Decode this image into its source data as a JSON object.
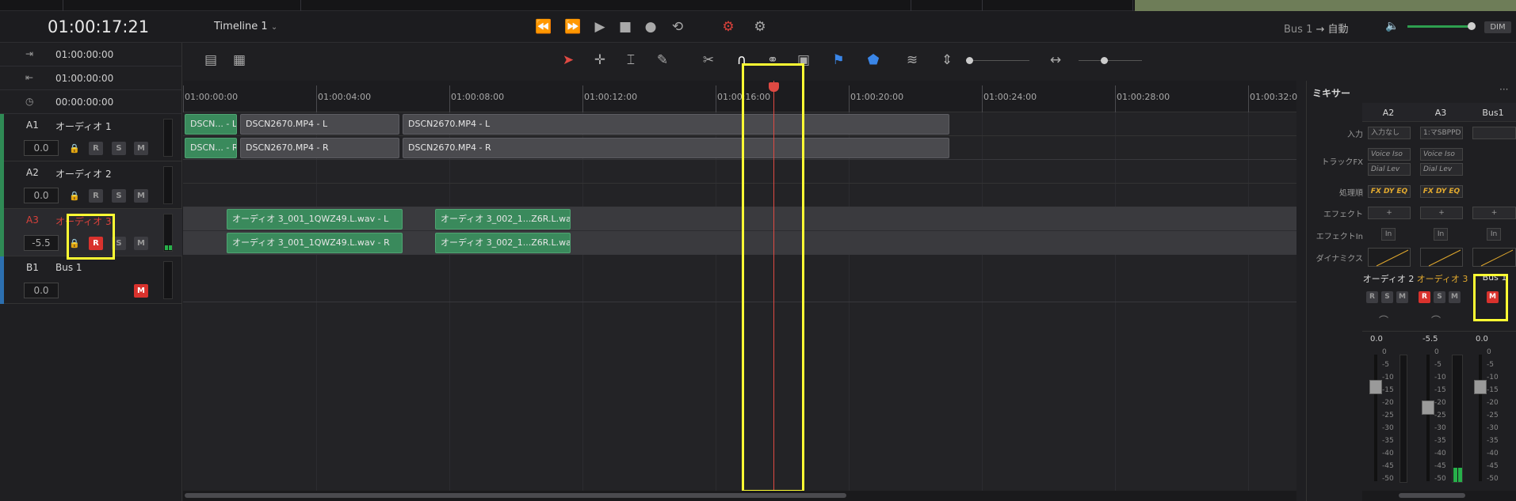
{
  "header": {
    "timecode": "01:00:17:21",
    "timeline_name": "Timeline 1",
    "bus_route": "Bus 1",
    "route_target": "自動",
    "dim_label": "DIM"
  },
  "left_panel": {
    "timecodes": [
      {
        "icon": "in-point-icon",
        "value": "01:00:00:00"
      },
      {
        "icon": "out-point-icon",
        "value": "01:00:00:00"
      },
      {
        "icon": "duration-icon",
        "value": "00:00:00:00"
      }
    ],
    "tracks": [
      {
        "id": "A1",
        "name": "オーディオ 1",
        "volume": "0.0",
        "color": "#2f8a55",
        "buttons": [
          "R",
          "S",
          "M"
        ]
      },
      {
        "id": "A2",
        "name": "オーディオ 2",
        "volume": "0.0",
        "color": "#2f8a55",
        "buttons": [
          "R",
          "S",
          "M"
        ]
      },
      {
        "id": "A3",
        "name": "オーディオ 3",
        "volume": "-5.5",
        "color": "#2f8a55",
        "buttons": [
          "R",
          "S",
          "M"
        ],
        "armed": true
      },
      {
        "id": "B1",
        "name": "Bus 1",
        "volume": "0.0",
        "color": "#2c6fb0",
        "buttons": [
          "M"
        ]
      }
    ]
  },
  "ruler": {
    "labels": [
      "01:00:00:00",
      "01:00:04:00",
      "01:00:08:00",
      "01:00:12:00",
      "01:00:16:00",
      "01:00:20:00",
      "01:00:24:00",
      "01:00:28:00",
      "01:00:32:0"
    ]
  },
  "clips": {
    "a1_l": [
      "DSCN... - L",
      "DSCN2670.MP4 - L",
      "DSCN2670.MP4 - L"
    ],
    "a1_r": [
      "DSCN... - R",
      "DSCN2670.MP4 - R",
      "DSCN2670.MP4 - R"
    ],
    "a3_l": [
      "オーディオ 3_001_1QWZ49.L.wav - L",
      "オーディオ 3_002_1...Z6R.L.wav - L"
    ],
    "a3_r": [
      "オーディオ 3_001_1QWZ49.L.wav - R",
      "オーディオ 3_002_1...Z6R.L.wav - R"
    ]
  },
  "mixer": {
    "title": "ミキサー",
    "columns": [
      "A2",
      "A3",
      "Bus1"
    ],
    "row_labels": [
      "入力",
      "トラックFX",
      "処理順",
      "エフェクト",
      "エフェクトIn",
      "ダイナミクス"
    ],
    "input_values": [
      "入力なし",
      "1:マSBPPD",
      ""
    ],
    "trackfx": [
      [
        "Voice Iso",
        "Dial Lev"
      ],
      [
        "Voice Iso",
        "Dial Lev"
      ]
    ],
    "order": "FX DY EQ",
    "effect_add": "+",
    "effect_in": "In",
    "channel_names": [
      "オーディオ 2",
      "オーディオ 3",
      "Bus 1"
    ],
    "buttons": [
      "R",
      "S",
      "M"
    ],
    "volumes": [
      "0.0",
      "-5.5",
      "0.0"
    ],
    "db_scale": [
      "0",
      "-5",
      "-10",
      "-15",
      "-20",
      "-25",
      "-30",
      "-35",
      "-40",
      "-45",
      "-50"
    ]
  }
}
